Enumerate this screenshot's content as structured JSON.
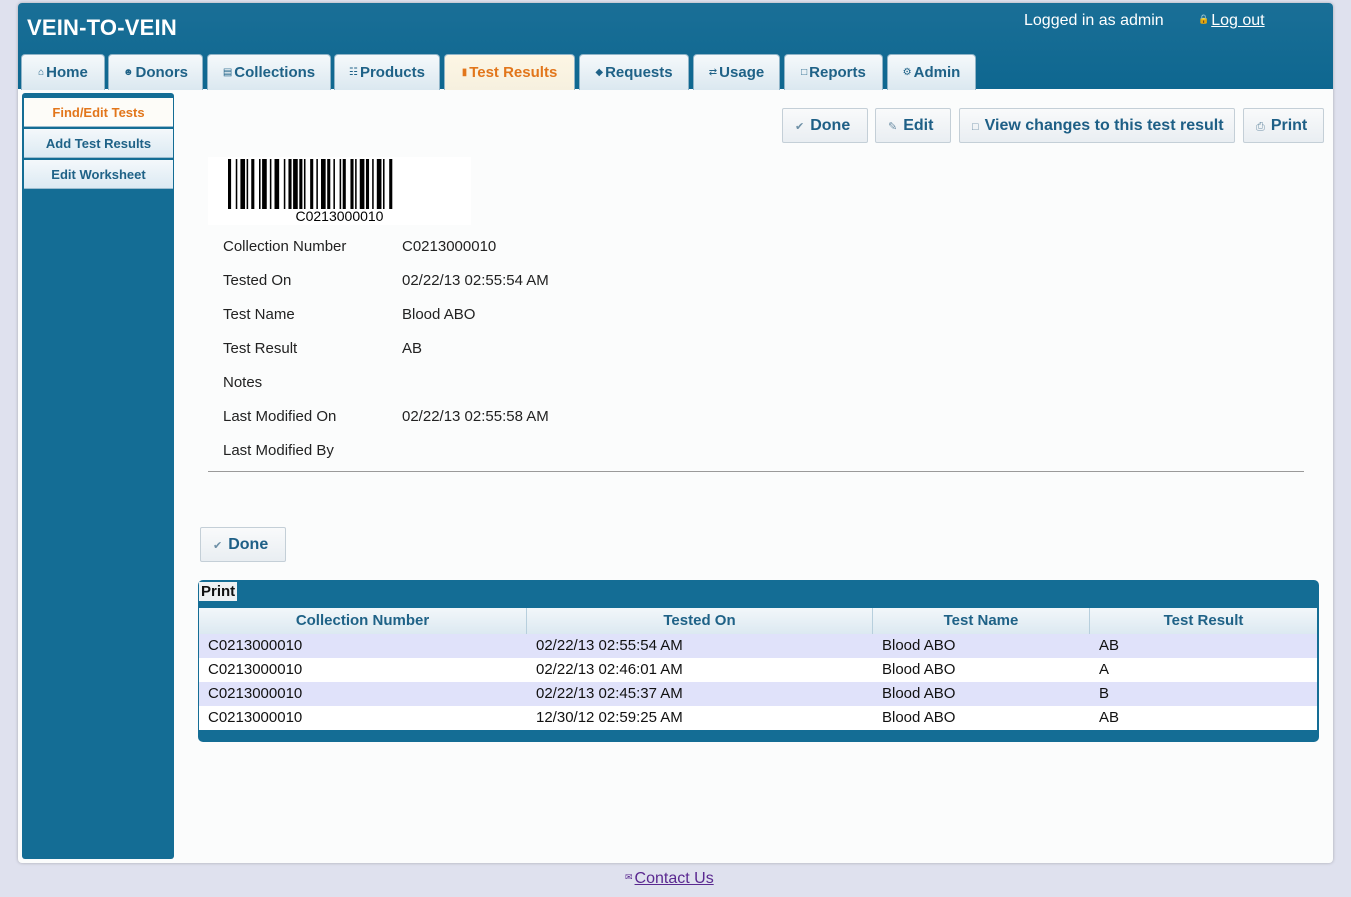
{
  "header": {
    "app_title": "VEIN-TO-VEIN",
    "login_status": "Logged in as admin",
    "logout_label": "Log out"
  },
  "tabs": [
    {
      "label": "Home",
      "icon": "home-icon"
    },
    {
      "label": "Donors",
      "icon": "user-icon"
    },
    {
      "label": "Collections",
      "icon": "database-icon"
    },
    {
      "label": "Products",
      "icon": "cart-icon"
    },
    {
      "label": "Test Results",
      "icon": "test-tube-icon",
      "active": true
    },
    {
      "label": "Requests",
      "icon": "tag-icon"
    },
    {
      "label": "Usage",
      "icon": "swap-arrows-icon"
    },
    {
      "label": "Reports",
      "icon": "clipboard-icon"
    },
    {
      "label": "Admin",
      "icon": "gear-icon"
    }
  ],
  "sidebar": {
    "items": [
      {
        "label": "Find/Edit Tests",
        "active": true
      },
      {
        "label": "Add Test Results"
      },
      {
        "label": "Edit Worksheet"
      }
    ]
  },
  "actions": {
    "done_label": "Done",
    "edit_label": "Edit",
    "view_changes_label": "View changes to this test result",
    "print_label": "Print"
  },
  "barcode": {
    "text": "C0213000010"
  },
  "details": {
    "collection_number": {
      "label": "Collection Number",
      "value": "C0213000010"
    },
    "tested_on": {
      "label": "Tested On",
      "value": "02/22/13 02:55:54 AM"
    },
    "test_name": {
      "label": "Test Name",
      "value": "Blood ABO"
    },
    "test_result": {
      "label": "Test Result",
      "value": "AB"
    },
    "notes": {
      "label": "Notes",
      "value": ""
    },
    "last_modified_on": {
      "label": "Last Modified On",
      "value": "02/22/13 02:55:58 AM"
    },
    "last_modified_by": {
      "label": "Last Modified By",
      "value": ""
    }
  },
  "bottom_done_label": "Done",
  "table": {
    "print_label": "Print",
    "columns": [
      "Collection Number",
      "Tested On",
      "Test Name",
      "Test Result"
    ],
    "rows": [
      [
        "C0213000010",
        "02/22/13 02:55:54 AM",
        "Blood ABO",
        "AB"
      ],
      [
        "C0213000010",
        "02/22/13 02:46:01 AM",
        "Blood ABO",
        "A"
      ],
      [
        "C0213000010",
        "02/22/13 02:45:37 AM",
        "Blood ABO",
        "B"
      ],
      [
        "C0213000010",
        "12/30/12 02:59:25 AM",
        "Blood ABO",
        "AB"
      ]
    ]
  },
  "footer": {
    "contact_label": "Contact Us"
  },
  "colors": {
    "brand_blue": "#146d95",
    "active_tab_text": "#e2761b",
    "tab_text": "#1f6287",
    "row_highlight": "#e0e2fa"
  }
}
